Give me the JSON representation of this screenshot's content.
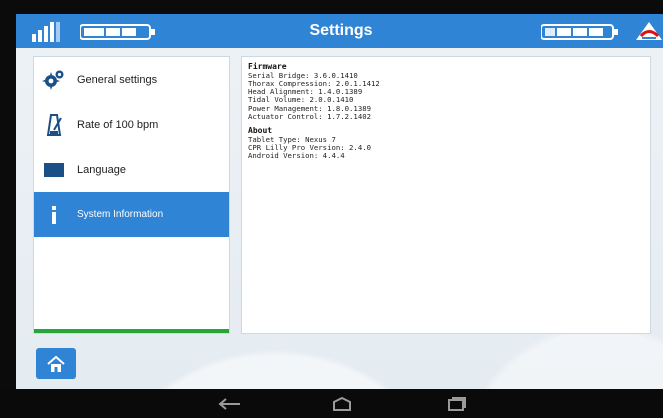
{
  "header": {
    "title": "Settings",
    "icons": [
      "signal-icon",
      "battery-icon",
      "battery-icon",
      "brand-logo-icon"
    ]
  },
  "menu": {
    "items": [
      {
        "label": "General settings",
        "icon": "gear-icon"
      },
      {
        "label": "Rate of 100 bpm",
        "icon": "metronome-icon"
      },
      {
        "label": "Language",
        "icon": "flag-icon"
      },
      {
        "label": "System Information",
        "icon": "info-icon"
      }
    ],
    "active_index": 3
  },
  "content": {
    "firmware_title": "Firmware",
    "firmware": [
      "Serial Bridge: 3.6.0.1410",
      "Thorax Compression: 2.0.1.1412",
      "Head Alignment: 1.4.0.1389",
      "Tidal Volume: 2.0.0.1410",
      "Power Management: 1.8.0.1389",
      "Actuator Control: 1.7.2.1402"
    ],
    "about_title": "About",
    "about": [
      "Tablet Type: Nexus 7",
      "CPR Lilly Pro Version: 2.4.0",
      "Android Version: 4.4.4"
    ]
  },
  "home_button": {
    "icon": "home-icon"
  },
  "nav": {
    "buttons": [
      "back-icon",
      "home-icon",
      "recent-apps-icon"
    ]
  },
  "colors": {
    "accent": "#2f84d6",
    "progress": "#26a53a"
  }
}
